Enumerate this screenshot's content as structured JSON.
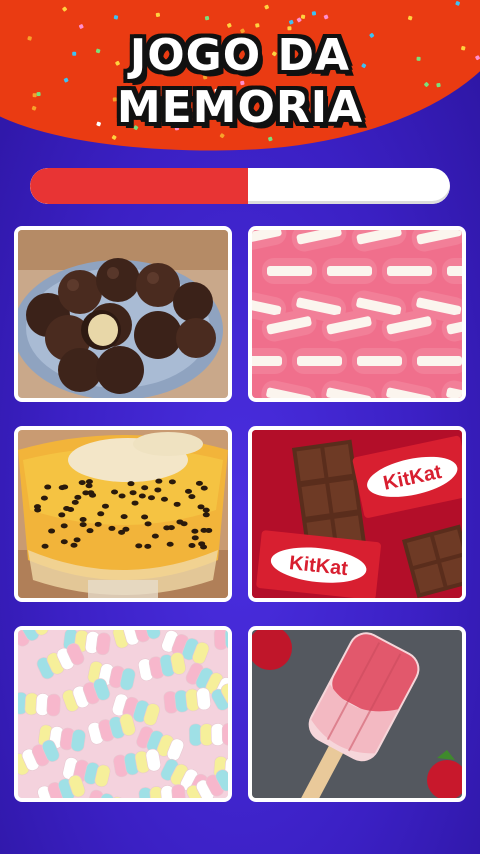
{
  "game": {
    "title_line1": "JOGO DA",
    "title_line2": "MEMORIA"
  },
  "progress": {
    "value": 0.52,
    "fill_color": "#e83434",
    "track_color": "#ffffff"
  },
  "theme": {
    "background": "#3b20c4",
    "banner": "#ea3b12",
    "card_border": "#ffffff"
  },
  "cards": [
    {
      "id": 1,
      "image": "chocolate-truffle-balls",
      "face_up": true
    },
    {
      "id": 2,
      "image": "gummy-teeth-candy",
      "face_up": true
    },
    {
      "id": 3,
      "image": "passion-fruit-mousse-cup",
      "face_up": true
    },
    {
      "id": 4,
      "image": "kitkat-chocolate-bars",
      "face_up": true
    },
    {
      "id": 5,
      "image": "twisted-marshmallows",
      "face_up": true
    },
    {
      "id": 6,
      "image": "strawberry-popsicle",
      "face_up": true
    }
  ],
  "kitkat_label": "KitKat"
}
